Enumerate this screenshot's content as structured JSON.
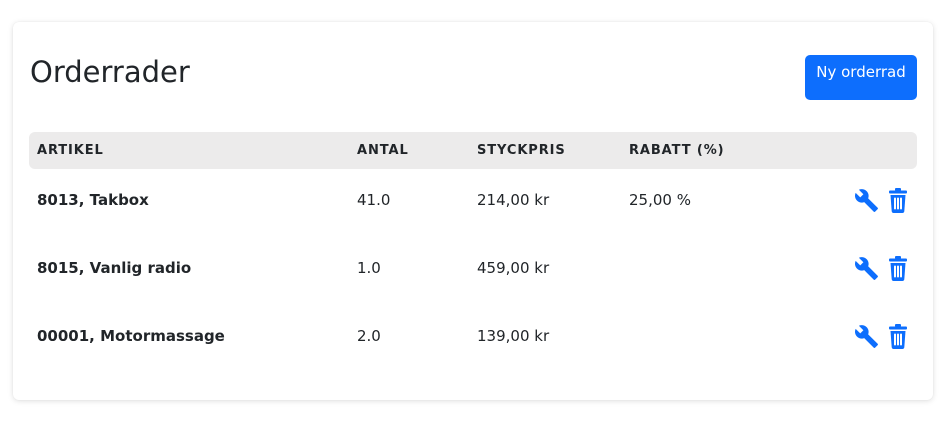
{
  "page": {
    "title": "Orderrader",
    "new_button_label": "Ny orderrad"
  },
  "table": {
    "headers": [
      "ARTIKEL",
      "ANTAL",
      "STYCKPRIS",
      "RABATT (%)"
    ],
    "rows": [
      {
        "article": "8013, Takbox",
        "quantity": "41.0",
        "unit_price": "214,00 kr",
        "discount": "25,00 %"
      },
      {
        "article": "8015, Vanlig radio",
        "quantity": "1.0",
        "unit_price": "459,00 kr",
        "discount": ""
      },
      {
        "article": "00001, Motormassage",
        "quantity": "2.0",
        "unit_price": "139,00 kr",
        "discount": ""
      }
    ],
    "row_actions": [
      "wrench-icon",
      "trash-icon"
    ]
  },
  "colors": {
    "accent": "#0d6efd",
    "header_background": "#ecebeb",
    "text": "#212529"
  }
}
